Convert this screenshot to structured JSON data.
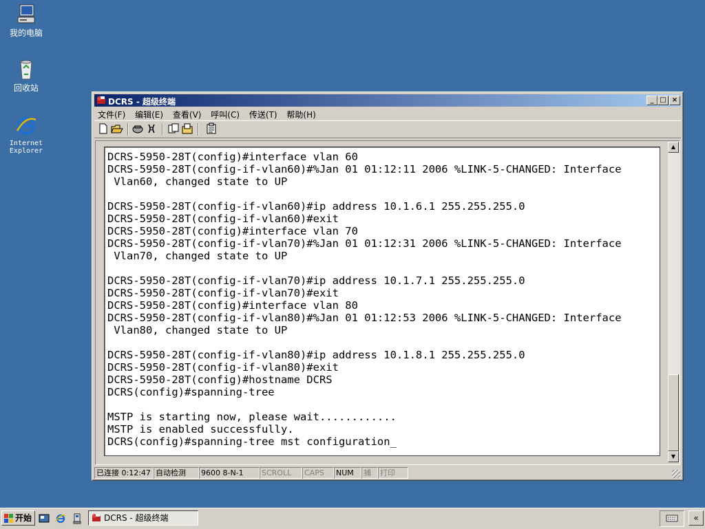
{
  "desktop": {
    "icons": [
      {
        "label": "我的电脑",
        "icon": "my-computer-icon"
      },
      {
        "label": "回收站",
        "icon": "recycle-bin-icon"
      },
      {
        "label_line1": "Internet",
        "label_line2": "Explorer",
        "icon": "internet-explorer-icon"
      }
    ]
  },
  "window": {
    "title": "DCRS - 超级终端",
    "menu": [
      "文件(F)",
      "编辑(E)",
      "查看(V)",
      "呼叫(C)",
      "传送(T)",
      "帮助(H)"
    ],
    "toolbar_icons": [
      "new-icon",
      "open-icon",
      "connect-icon",
      "disconnect-icon",
      "send-icon",
      "receive-icon",
      "properties-icon"
    ],
    "terminal_lines": [
      "DCRS-5950-28T(config)#interface vlan 60",
      "DCRS-5950-28T(config-if-vlan60)#%Jan 01 01:12:11 2006 %LINK-5-CHANGED: Interface",
      " Vlan60, changed state to UP",
      "",
      "DCRS-5950-28T(config-if-vlan60)#ip address 10.1.6.1 255.255.255.0",
      "DCRS-5950-28T(config-if-vlan60)#exit",
      "DCRS-5950-28T(config)#interface vlan 70",
      "DCRS-5950-28T(config-if-vlan70)#%Jan 01 01:12:31 2006 %LINK-5-CHANGED: Interface",
      " Vlan70, changed state to UP",
      "",
      "DCRS-5950-28T(config-if-vlan70)#ip address 10.1.7.1 255.255.255.0",
      "DCRS-5950-28T(config-if-vlan70)#exit",
      "DCRS-5950-28T(config)#interface vlan 80",
      "DCRS-5950-28T(config-if-vlan80)#%Jan 01 01:12:53 2006 %LINK-5-CHANGED: Interface",
      " Vlan80, changed state to UP",
      "",
      "DCRS-5950-28T(config-if-vlan80)#ip address 10.1.8.1 255.255.255.0",
      "DCRS-5950-28T(config-if-vlan80)#exit",
      "DCRS-5950-28T(config)#hostname DCRS",
      "DCRS(config)#spanning-tree",
      "",
      "MSTP is starting now, please wait............",
      "MSTP is enabled successfully.",
      "DCRS(config)#spanning-tree mst configuration_"
    ],
    "status": {
      "connected": "已连接 0:12:47",
      "detect": "自动检测",
      "settings": "9600 8-N-1",
      "scroll": "SCROLL",
      "caps": "CAPS",
      "num": "NUM",
      "capture": "捕",
      "print": "打印"
    }
  },
  "taskbar": {
    "start_label": "开始",
    "quicklaunch": [
      "show-desktop-icon",
      "internet-explorer-icon",
      "windows-explorer-icon"
    ],
    "task_title": "DCRS - 超级终端"
  }
}
